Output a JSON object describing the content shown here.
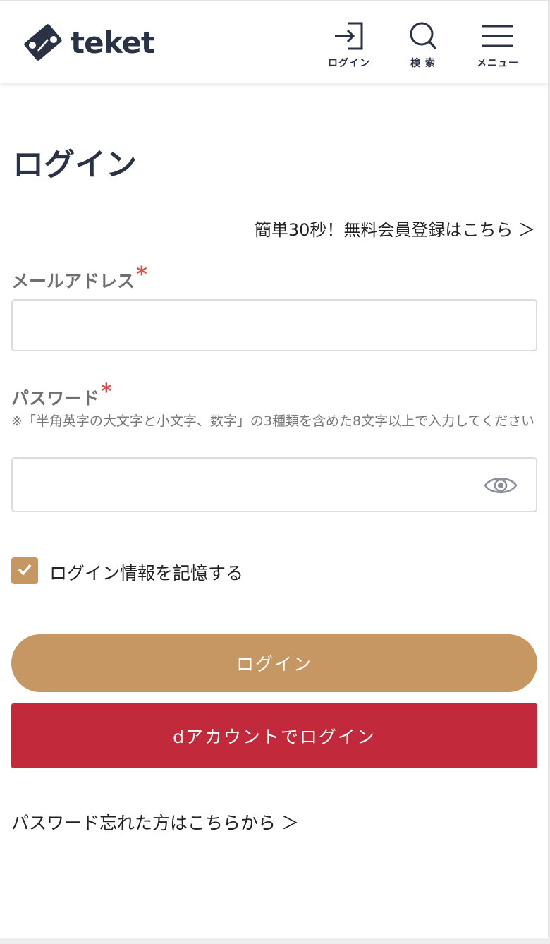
{
  "header": {
    "logo_text": "teket",
    "nav": {
      "login_label": "ログイン",
      "search_label": "検 索",
      "menu_label": "メニュー"
    }
  },
  "main": {
    "title": "ログイン",
    "signup_link": "簡単30秒！無料会員登録はこちら ＞",
    "email": {
      "label": "メールアドレス",
      "required_mark": "*",
      "value": ""
    },
    "password": {
      "label": "パスワード",
      "required_mark": "*",
      "note": "※「半角英字の大文字と小文字、数字」の3種類を含めた8文字以上で入力してください",
      "value": ""
    },
    "remember": {
      "label": "ログイン情報を記憶する",
      "checked": true
    },
    "login_button": "ログイン",
    "d_account_button": "dアカウントでログイン",
    "forgot_link": "パスワード忘れた方はこちらから ＞"
  },
  "colors": {
    "brand_navy": "#2b3245",
    "accent_gold": "#c69663",
    "d_account_red": "#c2293a",
    "required_red": "#e24b4b"
  },
  "icons": {
    "logo": "ticket-logo-icon",
    "login": "login-arrow-icon",
    "search": "search-icon",
    "menu": "hamburger-menu-icon",
    "password_toggle": "eye-icon",
    "checkbox": "checkmark-icon"
  }
}
